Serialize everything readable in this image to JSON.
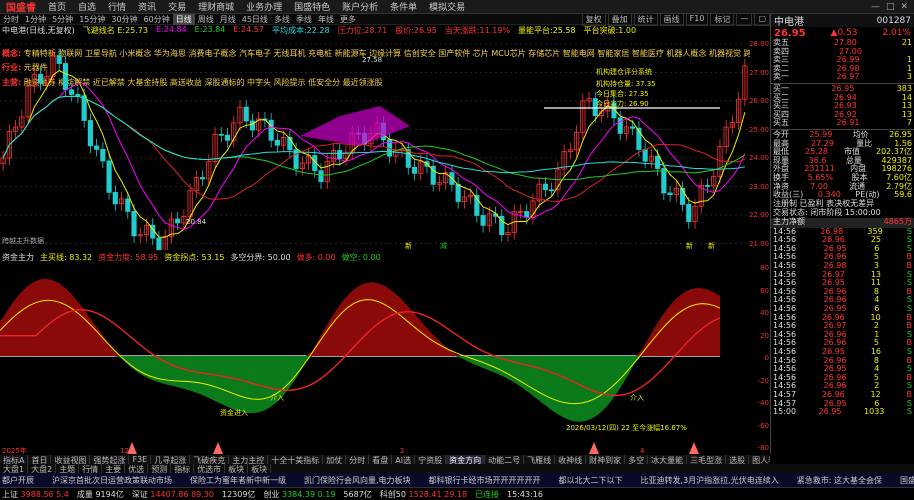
{
  "app": {
    "logo": "国盛睿",
    "title": "中电港"
  },
  "menu": [
    "首页",
    "自选",
    "行情",
    "资讯",
    "交易",
    "理财商城",
    "业务办理",
    "国盛特色",
    "账户分析",
    "条件单",
    "模拟交易"
  ],
  "window_controls": [
    "—",
    "□",
    "✕"
  ],
  "periods": [
    "分时",
    "1分钟",
    "5分钟",
    "15分钟",
    "30分钟",
    "60分钟",
    "日线",
    "周线",
    "月线",
    "45日线",
    "多线",
    "季线",
    "年线",
    "更多"
  ],
  "active_period": "日线",
  "right_buttons": [
    "复权",
    "叠加",
    "统计",
    "画线",
    "F10",
    "标记",
    "—",
    "▢"
  ],
  "ma_line": [
    {
      "text": "中电港(日线,无复权)",
      "color": "#ddd"
    },
    {
      "text": "飞避线名 E:25.73",
      "color": "#ee0"
    },
    {
      "text": "E:24.84",
      "color": "#f0f"
    },
    {
      "text": "E:23.84",
      "color": "#2c2"
    },
    {
      "text": "E:24.57",
      "color": "#f33"
    },
    {
      "text": "平均成本:22.28",
      "color": "#2dd"
    },
    {
      "text": "压力位:28.71",
      "color": "#f33"
    },
    {
      "text": "股价:26.95",
      "color": "#f33"
    },
    {
      "text": "当天涨跌:11.19%",
      "color": "#f33"
    },
    {
      "text": "量能平台:25.58",
      "color": "#ee0"
    },
    {
      "text": "平台突破:1.00",
      "color": "#ee0"
    }
  ],
  "concepts": {
    "row1_tag": "概念:",
    "row1": "专精特新 物联网 卫星导航 小米概念 华为海思 消费电子概念 汽车电子 无线耳机 充电桩 新能源车 边缘计算 信创安全 国产软件 芯片 MCU芯片 存储芯片 智能电网 智能家居 智能医疗 机器人概念 机器视觉 跨境电商 人工智能 储能 数据要素 全球彩票日 英伟达概念 星闪概念",
    "row2_tag": "行业:",
    "row2": "元器件",
    "row3_tag": "主营:",
    "row3": "融资融券 柳坊解禁 近已解禁 大基金持股 高送收益 深股通标的 中字头 风险提示 低安全分 最近领涨股"
  },
  "chart_data": {
    "type": "candlestick",
    "price_axis": [
      "28.00",
      "27.00",
      "26.00",
      "25.00",
      "24.00",
      "23.00",
      "22.00",
      "21.00"
    ],
    "annotations": [
      "27.58",
      "20.84",
      "机构建仓评分系统",
      "机构持仓量: 37.35",
      "今日集合: 27.35",
      "今日主力: 26.90"
    ],
    "signal_labels": [
      "新",
      "减",
      "新",
      "新"
    ],
    "vol_label": "跨越主升数据",
    "sub_title": "资金主力",
    "sub_axis": [
      "80",
      "60",
      "40",
      "20",
      "0",
      "-20",
      "-40",
      "-60",
      "-80"
    ],
    "sub_legend": [
      {
        "text": "主买线: 83.32",
        "color": "#ee0"
      },
      {
        "text": "资金力度: 58.95",
        "color": "#f33"
      },
      {
        "text": "资金拐点: 53.15",
        "color": "#ee0"
      },
      {
        "text": "多空分界: 50.00",
        "color": "#ddd"
      },
      {
        "text": "做多: 0.00",
        "color": "#f33"
      },
      {
        "text": "做空: 0.00",
        "color": "#2c2"
      }
    ],
    "sub_annotations": [
      "介入",
      "介入",
      "资金进入"
    ],
    "date_axis": [
      "2025年",
      "12",
      "2",
      "4"
    ],
    "date_hint": "2026/03/12(四) 22 至今涨幅16.67%"
  },
  "quote": {
    "code": "001287",
    "price": "26.95",
    "change": "▲0.53",
    "pct": "2.01%",
    "asks": [
      {
        "label": "卖五",
        "price": "27.80",
        "vol": "21"
      },
      {
        "label": "卖四",
        "price": "27.00",
        "vol": ""
      },
      {
        "label": "卖三",
        "price": "26.99",
        "vol": "1"
      },
      {
        "label": "卖二",
        "price": "26.98",
        "vol": "1"
      },
      {
        "label": "卖一",
        "price": "26.97",
        "vol": "3"
      }
    ],
    "bids": [
      {
        "label": "买一",
        "price": "26.95",
        "vol": "383"
      },
      {
        "label": "买二",
        "price": "26.94",
        "vol": "14"
      },
      {
        "label": "买三",
        "price": "26.93",
        "vol": "13"
      },
      {
        "label": "买四",
        "price": "26.92",
        "vol": "13"
      },
      {
        "label": "买五",
        "price": "26.91",
        "vol": "7"
      }
    ],
    "stats": [
      {
        "a": "今开",
        "b": "25.99",
        "c": "均价",
        "d": "26.95"
      },
      {
        "a": "最高",
        "b": "27.29",
        "c": "量比",
        "d": "1.56"
      },
      {
        "a": "最低",
        "b": "25.28",
        "c": "市值",
        "d": "202.37亿"
      },
      {
        "a": "现量",
        "b": "36.6",
        "c": "总量",
        "d": "429387"
      },
      {
        "a": "外盘",
        "b": "231111",
        "c": "内盘",
        "d": "198276"
      },
      {
        "a": "换手",
        "b": "5.65%",
        "c": "股本",
        "d": "7.60亿"
      },
      {
        "a": "净资",
        "b": "7.00",
        "c": "流通",
        "d": "2.79亿"
      },
      {
        "a": "收益(三)",
        "b": "0.340",
        "c": "PE(动)",
        "d": "59.6"
      }
    ],
    "status1": "注册制 已盈利 表决权无差异",
    "status2": "交易状态: 闭市阶段 15:00:00",
    "flow_label": "主力净额",
    "flow_value": "4865万",
    "ticks": [
      [
        "14:56",
        "26.98",
        "359",
        "S"
      ],
      [
        "14:56",
        "26.96",
        "25",
        "S"
      ],
      [
        "14:56",
        "26.95",
        "6",
        "S"
      ],
      [
        "14:56",
        "26.96",
        "5",
        "B"
      ],
      [
        "14:56",
        "26.98",
        "3",
        "B"
      ],
      [
        "14:56",
        "26.97",
        "13",
        "S"
      ],
      [
        "14:56",
        "26.95",
        "11",
        "S"
      ],
      [
        "14:56",
        "26.96",
        "8",
        "B"
      ],
      [
        "14:56",
        "26.96",
        "4",
        "S"
      ],
      [
        "14:56",
        "26.95",
        "6",
        "S"
      ],
      [
        "14:56",
        "26.96",
        "10",
        "B"
      ],
      [
        "14:56",
        "26.97",
        "2",
        "B"
      ],
      [
        "14:56",
        "26.96",
        "1",
        "S"
      ],
      [
        "14:56",
        "26.96",
        "5",
        "B"
      ],
      [
        "14:56",
        "26.95",
        "16",
        "S"
      ],
      [
        "14:56",
        "26.96",
        "8",
        "B"
      ],
      [
        "14:56",
        "26.95",
        "4",
        "S"
      ],
      [
        "14:56",
        "26.96",
        "5",
        "B"
      ],
      [
        "14:56",
        "26.96",
        "2",
        "S"
      ],
      [
        "14:57",
        "26.96",
        "12",
        "B"
      ],
      [
        "14:57",
        "26.95",
        "6",
        "S"
      ],
      [
        "15:00",
        "26.95",
        "1033",
        "S"
      ]
    ]
  },
  "tabs": [
    "指标A",
    "首日",
    "收益视图",
    "强势起涨",
    "F3E",
    "几寻起涨",
    "飞破疾克",
    "主力主控",
    "十全十美指标",
    "加仗",
    "分时",
    "看盘",
    "AI选",
    "宁资股",
    "资金方向",
    "动能二号",
    "飞雁线",
    "收神线",
    "财神到家",
    "多空",
    "冰大量能",
    "三毛型涨",
    "选股",
    "图人看盘",
    "MACD",
    "新目四公式",
    "获利决策",
    "抓龙大涨"
  ],
  "active_tab": "资金方向",
  "tabs2": [
    "大盘1",
    "大盘2",
    "主题",
    "行情",
    "主要",
    "优选",
    "预测",
    "指标",
    "优选市",
    "板块",
    "板块"
  ],
  "news": [
    "都户开辰",
    "沪深京首批次日运营政策联动市场",
    "保险工为蜜年者新中新一级",
    "凯门保险行会风向量,电力板块",
    "都科银行卡经市场开开开开开开",
    "都以北大二下以下",
    "比亚迪转发,3月沪指涨拉,光伏电连续入",
    "紧急救市: 这大基全会保",
    "国盛公告",
    "公告"
  ],
  "status": [
    {
      "label": "上证",
      "value": "3988.56",
      "change": "5.4",
      "color": "#f33"
    },
    {
      "label": "成量",
      "value": "9194亿",
      "change": "",
      "color": "#ddd"
    },
    {
      "label": "深证",
      "value": "14407.86",
      "change": "89.30",
      "color": "#f33"
    },
    {
      "label": "",
      "value": "12309亿",
      "change": "",
      "color": "#ddd"
    },
    {
      "label": "创业",
      "value": "3384.39",
      "change": "0.19",
      "color": "#2c2"
    },
    {
      "label": "",
      "value": "5687亿",
      "change": "",
      "color": "#ddd"
    },
    {
      "label": "科创50",
      "value": "1528.41",
      "change": "29.18",
      "color": "#f33"
    },
    {
      "label": "",
      "value": "已连接",
      "change": "",
      "color": "#2c2"
    },
    {
      "label": "",
      "value": "15:43:16",
      "change": "",
      "color": "#ddd"
    }
  ]
}
